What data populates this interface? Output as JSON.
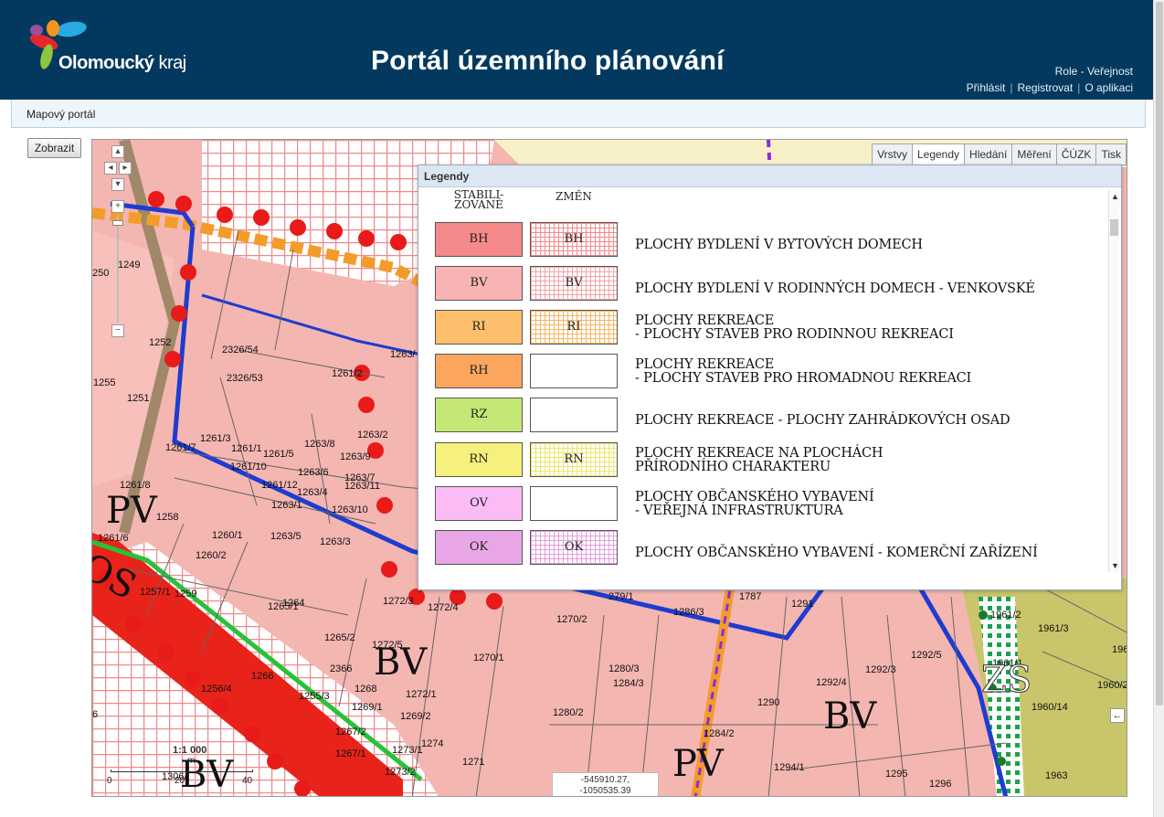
{
  "header": {
    "logo_brand": "Olomoucký",
    "logo_brand_suffix": "kraj",
    "title": "Portál územního plánování",
    "role": "Role - Veřejnost",
    "links": [
      "Přihlásit",
      "Registrovat",
      "O aplikaci"
    ]
  },
  "breadcrumb": "Mapový portál",
  "show_button": "Zobrazit",
  "map": {
    "tabs": [
      {
        "label": "Vrstvy",
        "active": false
      },
      {
        "label": "Legendy",
        "active": true
      },
      {
        "label": "Hledání",
        "active": false
      },
      {
        "label": "Měření",
        "active": false
      },
      {
        "label": "ČÚZK",
        "active": false
      },
      {
        "label": "Tisk",
        "active": false
      }
    ],
    "zoom_in": "+",
    "zoom_out": "−",
    "scale": {
      "label": "1:1 000",
      "unit": "m",
      "ticks": [
        "0",
        "20",
        "40"
      ]
    },
    "coordinates": [
      "-545910.27,",
      "-1050535.39"
    ],
    "parcel_labels": [
      "1249",
      "250",
      "1252",
      "2326/54",
      "2326/53",
      "1255",
      "1251",
      "1261/2",
      "1263/",
      "1261/3",
      "1261/7",
      "1261/1",
      "1261/5",
      "1263/8",
      "1263/2",
      "1263/9",
      "1261/8",
      "1261/10",
      "1261/12",
      "1263/6",
      "1263/7",
      "1263/11",
      "1263/4",
      "1263/1",
      "1263/10",
      "1258",
      "1260/1",
      "1263/5",
      "1263/3",
      "1261/6",
      "1260/2",
      "1257/1",
      "1259",
      "1265/1",
      "1264",
      "1272/3",
      "1272/4",
      "1270/2",
      "1286/3",
      "1291",
      "1961/2",
      "1961/3",
      "196",
      "1265/2",
      "1272/5",
      "1270/1",
      "1280/3",
      "1284/3",
      "1292/5",
      "1961/1",
      "2366",
      "1266",
      "1256/4",
      "1268",
      "1272/1",
      "1292/4",
      "1292/3",
      "1960/2",
      "1255/3",
      "1269/1",
      "1269/2",
      "1280/2",
      "1290",
      "1960/14",
      "6",
      "1267/2",
      "1274",
      "1284/2",
      "1267/1",
      "1273/1",
      "1271",
      "1273/2",
      "1306/",
      "1294/1",
      "1295",
      "1296",
      "1963",
      "1787",
      "279/1"
    ],
    "zone_labels": [
      "PV",
      "BV",
      "BV",
      "BV",
      "PV",
      "BV",
      "ZS",
      "OS"
    ],
    "colors": {
      "housing": "#f4b4ae",
      "road": "#e8231a",
      "boundary": "#1e3ccf",
      "points": "#e81a1a",
      "orange_line": "#f39c2a",
      "garden": "#c9c56a",
      "header": "#03395f"
    }
  },
  "legend": {
    "title": "Legendy",
    "col_stabilized": [
      "STABILI-",
      "ZOVANÉ"
    ],
    "col_changes": [
      "ZMĚN"
    ],
    "items": [
      {
        "code": "BH",
        "proposed": "BH",
        "color": "#f6898a",
        "pattern": "#f6898a",
        "text": [
          "PLOCHY BYDLENÍ V BYTOVÝCH DOMECH"
        ]
      },
      {
        "code": "BV",
        "proposed": "BV",
        "color": "#f8b3b4",
        "pattern": "#f4a5a8",
        "text": [
          "PLOCHY BYDLENÍ V RODINNÝCH DOMECH - VENKOVSKÉ"
        ]
      },
      {
        "code": "RI",
        "proposed": "RI",
        "color": "#fdbf6c",
        "pattern": "#f8b461",
        "text": [
          "PLOCHY REKREACE",
          "- PLOCHY STAVEB PRO RODINNOU REKREACI"
        ]
      },
      {
        "code": "RH",
        "proposed": "",
        "color": "#fba55e",
        "pattern": "",
        "text": [
          "PLOCHY REKREACE",
          "- PLOCHY STAVEB PRO HROMADNOU REKREACI"
        ]
      },
      {
        "code": "RZ",
        "proposed": "",
        "color": "#c4e875",
        "pattern": "",
        "text": [
          "PLOCHY REKREACE - PLOCHY ZAHRÁDKOVÝCH OSAD"
        ]
      },
      {
        "code": "RN",
        "proposed": "RN",
        "color": "#f6f07c",
        "pattern": "#eee56b",
        "text": [
          "PLOCHY REKREACE NA PLOCHÁCH",
          "PŘÍRODNÍHO CHARAKTERU"
        ]
      },
      {
        "code": "OV",
        "proposed": "",
        "color": "#fbbcf5",
        "pattern": "",
        "text": [
          "PLOCHY OBČANSKÉHO VYBAVENÍ",
          "- VEŘEJNÁ INFRASTRUKTURA"
        ]
      },
      {
        "code": "OK",
        "proposed": "OK",
        "color": "#e9a6e6",
        "pattern": "#e39de0",
        "text": [
          "PLOCHY OBČANSKÉHO VYBAVENÍ - KOMERČNÍ ZAŘÍZENÍ"
        ]
      }
    ]
  }
}
